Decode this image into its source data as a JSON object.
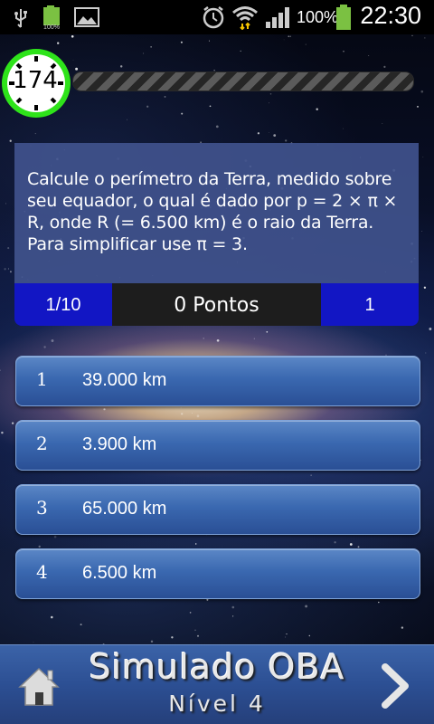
{
  "status_bar": {
    "time": "22:30",
    "battery_percent": "100%",
    "battery_level": 1.0,
    "icons": [
      "usb-icon",
      "battery-small-icon",
      "image-icon",
      "alarm-icon",
      "wifi-icon",
      "signal-icon",
      "battery-icon"
    ]
  },
  "timer": {
    "value": "174",
    "ring_color": "#2ee31a"
  },
  "question": {
    "text": "Calcule o perímetro da Terra, medido sobre seu equador, o qual é dado por p = 2 × π × R, onde R (= 6.500 km) é o raio da Terra. Para simplificar use π = 3."
  },
  "info": {
    "counter": "1/10",
    "points": "0 Pontos",
    "level": "1"
  },
  "answers": [
    {
      "number": "1",
      "text": "39.000 km"
    },
    {
      "number": "2",
      "text": "3.900 km"
    },
    {
      "number": "3",
      "text": "65.000 km"
    },
    {
      "number": "4",
      "text": "6.500 km"
    }
  ],
  "footer": {
    "title": "Simulado OBA",
    "subtitle": "Nível 4",
    "icons": [
      "home-icon",
      "chevron-right-icon"
    ]
  },
  "colors": {
    "panel": "#40528c",
    "accent_blue": "#1216c4",
    "button": "#3a68b0",
    "footer": "#2c4f93"
  }
}
